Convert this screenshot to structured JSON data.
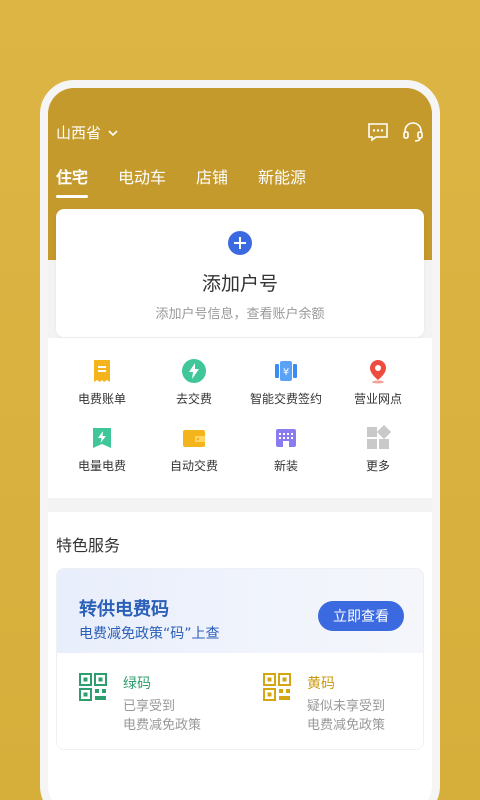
{
  "header": {
    "province": "山西省",
    "tabs": [
      {
        "label": "住宅",
        "active": true
      },
      {
        "label": "电动车",
        "active": false
      },
      {
        "label": "店铺",
        "active": false
      },
      {
        "label": "新能源",
        "active": false
      }
    ]
  },
  "add_account": {
    "title": "添加户号",
    "subtitle": "添加户号信息，查看账户余额"
  },
  "quick_grid": [
    {
      "label": "电费账单",
      "icon": "bill-icon"
    },
    {
      "label": "去交费",
      "icon": "lightning-pay-icon"
    },
    {
      "label": "智能交费签约",
      "icon": "smart-pay-icon"
    },
    {
      "label": "营业网点",
      "icon": "location-pin-icon"
    },
    {
      "label": "电量电费",
      "icon": "electricity-icon"
    },
    {
      "label": "自动交费",
      "icon": "wallet-icon"
    },
    {
      "label": "新装",
      "icon": "new-install-icon"
    },
    {
      "label": "更多",
      "icon": "more-grid-icon"
    }
  ],
  "special_services": {
    "title": "特色服务",
    "promo": {
      "title": "转供电费码",
      "subtitle": "电费减免政策“码”上查",
      "button": "立即查看"
    },
    "codes": [
      {
        "name": "绿码",
        "line1": "已享受到",
        "line2": "电费减免政策"
      },
      {
        "name": "黄码",
        "line1": "疑似未享受到",
        "line2": "电费减免政策"
      }
    ]
  },
  "colors": {
    "brand_gold": "#C49A2C",
    "primary_blue": "#3B6AE0",
    "green_code": "#2E9E6E",
    "yellow_code": "#C89A0F"
  }
}
